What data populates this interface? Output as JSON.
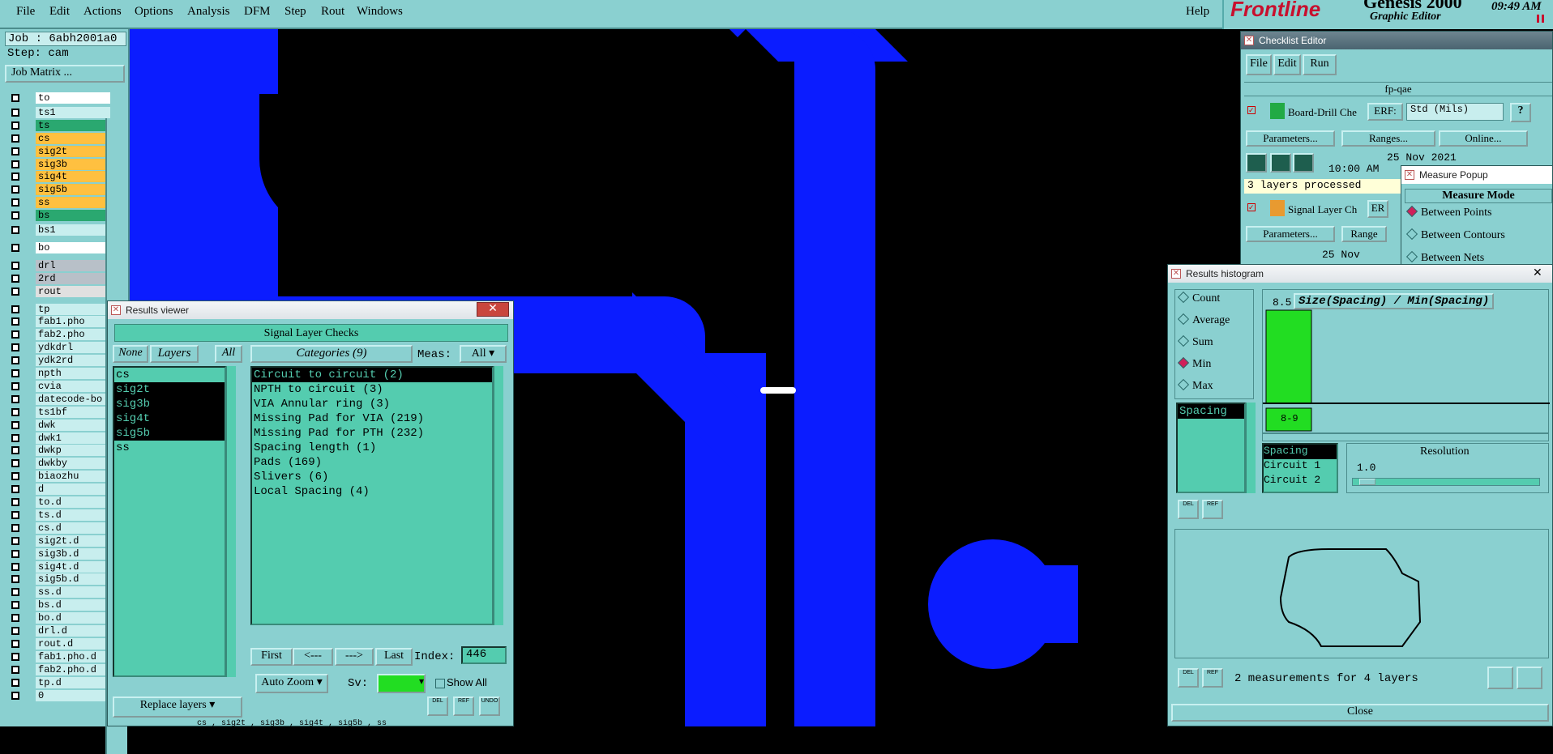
{
  "menu": {
    "items": [
      "File",
      "Edit",
      "Actions",
      "Options",
      "Analysis",
      "DFM",
      "Step",
      "Rout",
      "Windows"
    ],
    "help": "Help"
  },
  "brand": {
    "logo": "Frontline",
    "product": "Genesis 2000",
    "subtitle": "Graphic Editor",
    "time": "09:49 AM"
  },
  "job": {
    "job": "Job : 6abh2001a0",
    "step": "Step: cam",
    "matrix_button": "Job Matrix ..."
  },
  "layers": [
    {
      "name": "to",
      "color": "#ffffff"
    },
    {
      "name": "ts1",
      "color": "#c8eeee"
    },
    {
      "name": "ts",
      "color": "#2aa870"
    },
    {
      "name": "cs",
      "color": "#ffc040"
    },
    {
      "name": "sig2t",
      "color": "#ffc040"
    },
    {
      "name": "sig3b",
      "color": "#ffc040"
    },
    {
      "name": "sig4t",
      "color": "#ffc040"
    },
    {
      "name": "sig5b",
      "color": "#ffc040"
    },
    {
      "name": "ss",
      "color": "#ffc040"
    },
    {
      "name": "bs",
      "color": "#2aa870"
    },
    {
      "name": "bs1",
      "color": "#c8eeee"
    },
    {
      "name": "bo",
      "color": "#ffffff"
    },
    {
      "name": "drl",
      "color": "#b8c0c8"
    },
    {
      "name": "2rd",
      "color": "#b8c0c8"
    },
    {
      "name": "rout",
      "color": "#e0e0e0"
    },
    {
      "name": "tp",
      "color": "#c8eeee"
    },
    {
      "name": "fab1.pho",
      "color": "#c8eeee"
    },
    {
      "name": "fab2.pho",
      "color": "#c8eeee"
    },
    {
      "name": "ydkdrl",
      "color": "#c8eeee"
    },
    {
      "name": "ydk2rd",
      "color": "#c8eeee"
    },
    {
      "name": "npth",
      "color": "#c8eeee"
    },
    {
      "name": "cvia",
      "color": "#c8eeee"
    },
    {
      "name": "datecode-bo",
      "color": "#c8eeee"
    },
    {
      "name": "ts1bf",
      "color": "#c8eeee"
    },
    {
      "name": "dwk",
      "color": "#c8eeee"
    },
    {
      "name": "dwk1",
      "color": "#c8eeee"
    },
    {
      "name": "dwkp",
      "color": "#c8eeee"
    },
    {
      "name": "dwkby",
      "color": "#c8eeee"
    },
    {
      "name": "biaozhu",
      "color": "#c8eeee"
    },
    {
      "name": "d",
      "color": "#c8eeee"
    },
    {
      "name": "to.d",
      "color": "#c8eeee"
    },
    {
      "name": "ts.d",
      "color": "#c8eeee"
    },
    {
      "name": "cs.d",
      "color": "#c8eeee"
    },
    {
      "name": "sig2t.d",
      "color": "#c8eeee"
    },
    {
      "name": "sig3b.d",
      "color": "#c8eeee"
    },
    {
      "name": "sig4t.d",
      "color": "#c8eeee"
    },
    {
      "name": "sig5b.d",
      "color": "#c8eeee"
    },
    {
      "name": "ss.d",
      "color": "#c8eeee"
    },
    {
      "name": "bs.d",
      "color": "#c8eeee"
    },
    {
      "name": "bo.d",
      "color": "#c8eeee"
    },
    {
      "name": "drl.d",
      "color": "#c8eeee"
    },
    {
      "name": "rout.d",
      "color": "#c8eeee"
    },
    {
      "name": "fab1.pho.d",
      "color": "#c8eeee"
    },
    {
      "name": "fab2.pho.d",
      "color": "#c8eeee"
    },
    {
      "name": "tp.d",
      "color": "#c8eeee"
    },
    {
      "name": "0",
      "color": "#c8eeee"
    }
  ],
  "results_viewer": {
    "title": "Results viewer",
    "header": "Signal Layer Checks",
    "none_btn": "None",
    "layers_label": "Layers",
    "all_btn": "All",
    "categories_label": "Categories (9)",
    "meas_label": "Meas:",
    "meas_value": "All",
    "layer_list": [
      "cs",
      "sig2t",
      "sig3b",
      "sig4t",
      "sig5b",
      "ss"
    ],
    "categories": [
      "Circuit to circuit (2)",
      "NPTH to circuit (3)",
      "VIA Annular ring (3)",
      "Missing Pad for VIA (219)",
      "Missing Pad for PTH (232)",
      "Spacing length (1)",
      "Pads (169)",
      "Slivers (6)",
      "Local Spacing (4)"
    ],
    "first_btn": "First",
    "prev_btn": "<---",
    "next_btn": "--->",
    "last_btn": "Last",
    "index_label": "Index:",
    "index_value": "446",
    "auto_zoom": "Auto Zoom",
    "sv_label": "Sv:",
    "show_all": "Show All",
    "replace_layers": "Replace layers",
    "del_label": "DEL",
    "ref_label": "REF",
    "undo_label": "UNDO",
    "status": "cs , sig2t , sig3b , sig4t , sig5b , ss"
  },
  "checklist": {
    "title": "Checklist Editor",
    "menu": [
      "File",
      "Edit",
      "Run"
    ],
    "name": "fp-qae",
    "board_drill": "Board-Drill Che",
    "erf_label": "ERF:",
    "erf_value": "Std (Mils)",
    "help_btn": "?",
    "parameters_btn": "Parameters...",
    "ranges_btn": "Ranges...",
    "online_btn": "Online...",
    "date": "25 Nov 2021",
    "time": "10:00 AM",
    "processed": "3 layers processed",
    "signal_layer": "Signal Layer Ch",
    "erf_short": "ER",
    "parameters2": "Parameters...",
    "ranges2": "Range",
    "date2": "25 Nov"
  },
  "measure": {
    "title": "Measure Popup",
    "mode_label": "Measure Mode",
    "modes": [
      "Between Points",
      "Between Contours",
      "Between Nets"
    ]
  },
  "histogram": {
    "title": "Results histogram",
    "options": [
      "Count",
      "Average",
      "Sum",
      "Min",
      "Max"
    ],
    "selected_option": "Min",
    "measure_list": [
      "Spacing"
    ],
    "chart_title": "Size(Spacing) / Min(Spacing)",
    "bar_value": "8.5",
    "bar_bin": "8-9",
    "columns": [
      "Spacing",
      "Circuit 1",
      "Circuit 2"
    ],
    "resolution_label": "Resolution",
    "resolution_value": "1.0",
    "summary": "2 measurements for 4 layers",
    "close_btn": "Close",
    "del_label": "DEL",
    "ref_label": "REF"
  },
  "chart_data": {
    "type": "bar",
    "title": "Size(Spacing) / Min(Spacing)",
    "categories": [
      "8-9"
    ],
    "values": [
      8.5
    ],
    "xlabel": "",
    "ylabel": ""
  },
  "colors": {
    "panel": "#8ad0d0",
    "list": "#54ccaf",
    "copper": "#0b1cff",
    "bar": "#22dd22"
  }
}
